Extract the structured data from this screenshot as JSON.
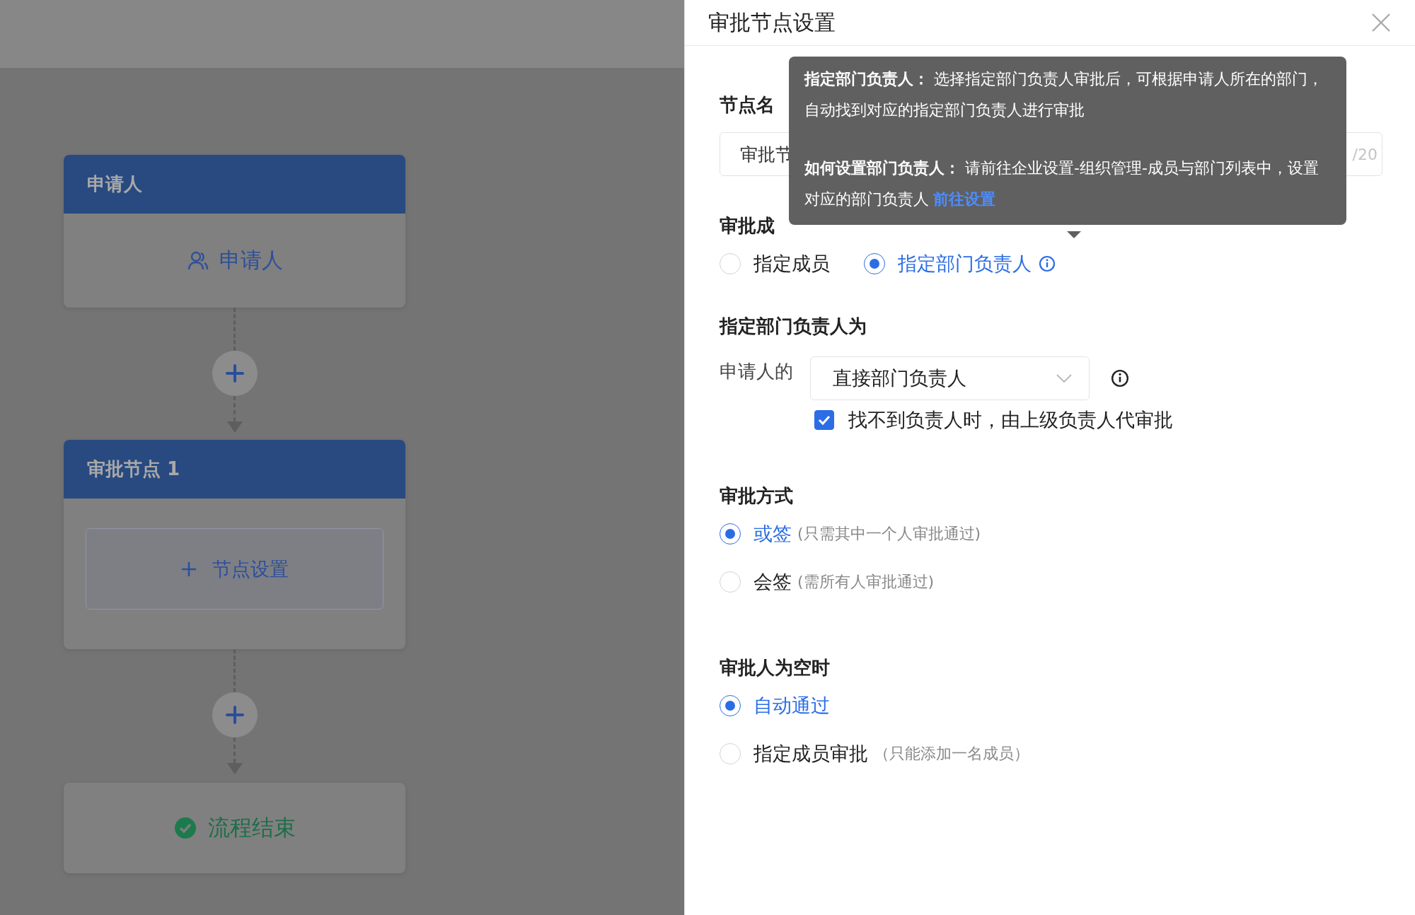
{
  "flow": {
    "nodes": [
      {
        "kind": "start",
        "title": "申请人",
        "body": "申请人"
      },
      {
        "kind": "approval",
        "title": "审批节点 1",
        "body": "节点设置"
      },
      {
        "kind": "end",
        "body": "流程结束"
      }
    ]
  },
  "drawer": {
    "title": "审批节点设置",
    "node_name": {
      "label": "节点名",
      "value": "审批节",
      "counter": "/20"
    },
    "members": {
      "label": "审批成",
      "options": [
        {
          "label": "指定成员",
          "selected": false,
          "info": false
        },
        {
          "label": "指定部门负责人",
          "selected": true,
          "info": true
        }
      ]
    },
    "leader": {
      "label": "指定部门负责人为",
      "prefix": "申请人的",
      "select": "直接部门负责人",
      "fallback": {
        "label": "找不到负责人时，由上级负责人代审批",
        "checked": true
      }
    },
    "mode": {
      "label": "审批方式",
      "options": [
        {
          "label": "或签",
          "note": "(只需其中一个人审批通过)",
          "selected": true
        },
        {
          "label": "会签",
          "note": "(需所有人审批通过)",
          "selected": false
        }
      ]
    },
    "empty": {
      "label": "审批人为空时",
      "options": [
        {
          "label": "自动通过",
          "selected": true
        },
        {
          "label": "指定成员审批",
          "note": "（只能添加一名成员）",
          "selected": false
        }
      ]
    },
    "tooltip": {
      "paragraphs": [
        {
          "text": "**指定部门负责人：** 选择指定部门负责人审批后，可根据申请人所在的部门，自动找到对应的指定部门负责人进行审批"
        },
        {
          "text": "**如何设置部门负责人：** 请前往企业设置-组织管理-成员与部门列表中，设置对应的部门负责人",
          "link": "前往设置"
        }
      ]
    }
  }
}
